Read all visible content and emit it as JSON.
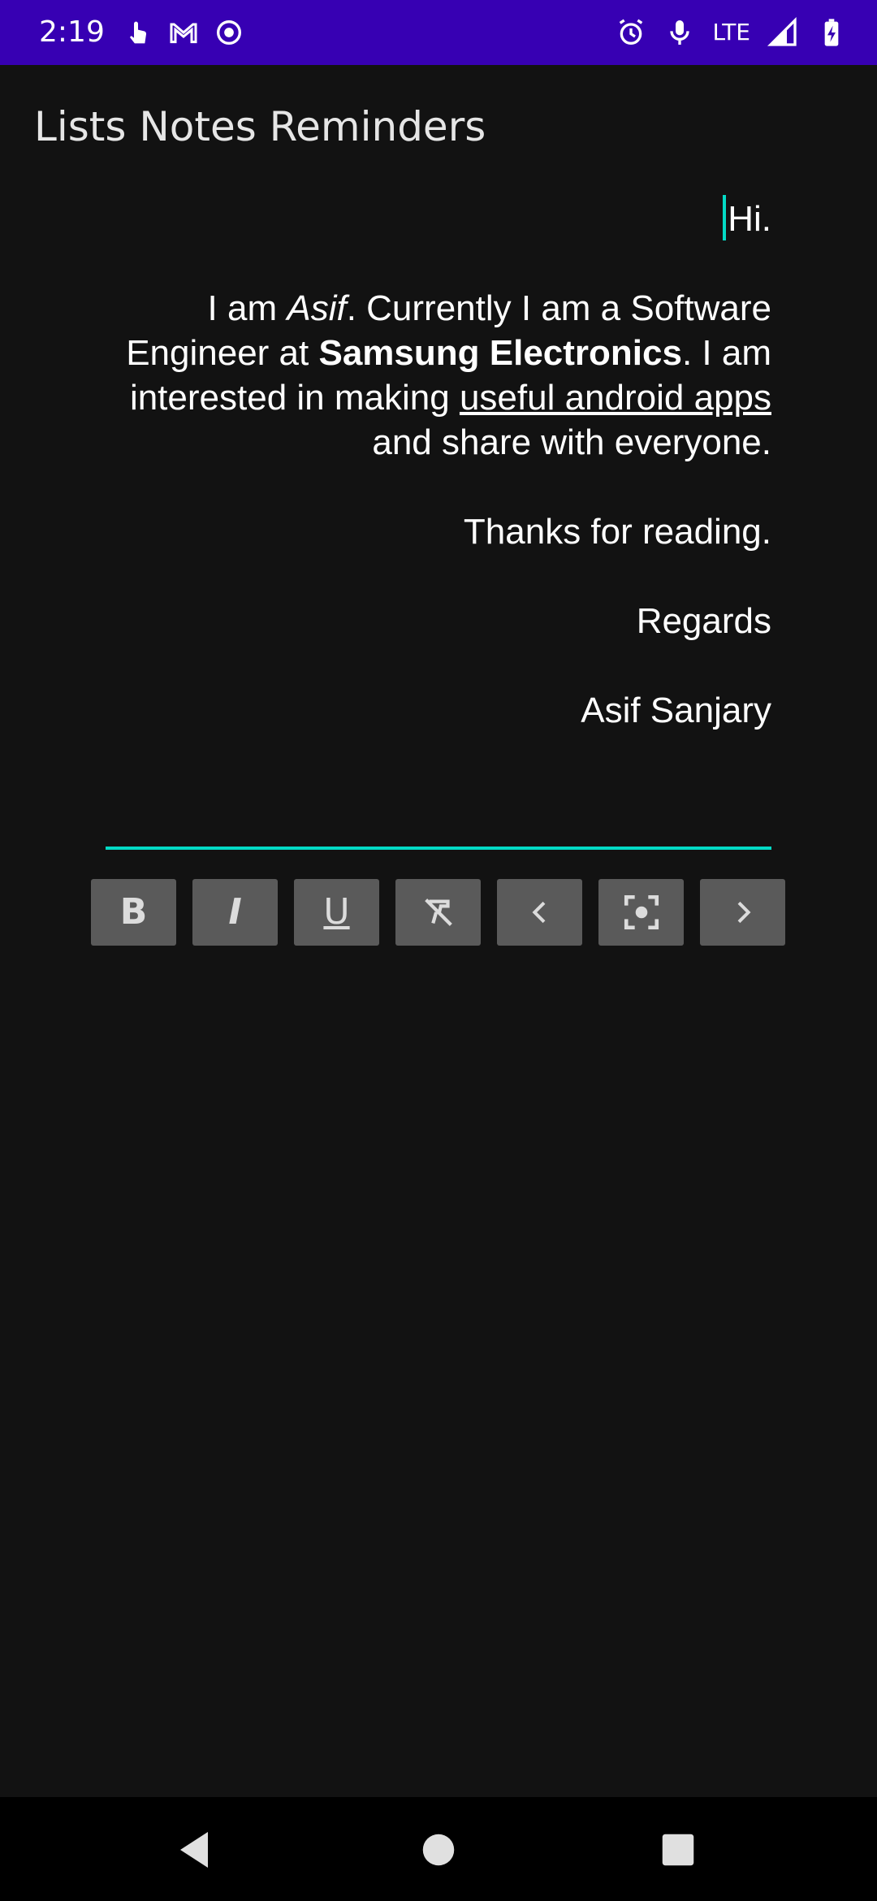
{
  "status_bar": {
    "time": "2:19",
    "network": "LTE",
    "icons_left": [
      "touch-icon",
      "gmail-icon",
      "record-icon"
    ],
    "icons_right": [
      "alarm-icon",
      "microphone-icon",
      "signal-icon",
      "battery-charging-icon"
    ],
    "background_color": "#3700b3"
  },
  "app_bar": {
    "title": "Lists Notes Reminders"
  },
  "editor": {
    "accent_color": "#03dac5",
    "greeting": "Hi.",
    "intro": {
      "t1": "I am ",
      "name_italic": "Asif",
      "t2": ". Currently I am a Software Engineer at ",
      "company_bold": "Samsung Electronics",
      "t3": ". I am interested in making ",
      "underlined": "useful android apps",
      "t4": " and share with everyone."
    },
    "thanks": "Thanks for reading.",
    "regards": "Regards",
    "signature": "Asif Sanjary"
  },
  "toolbar": {
    "buttons": [
      {
        "name": "bold",
        "glyph": "B"
      },
      {
        "name": "italic",
        "glyph": "I"
      },
      {
        "name": "underline",
        "glyph": "U"
      },
      {
        "name": "clear-format",
        "glyph": "T"
      },
      {
        "name": "previous",
        "glyph": "‹"
      },
      {
        "name": "capture",
        "glyph": "◉"
      },
      {
        "name": "next",
        "glyph": "›"
      }
    ]
  },
  "nav_bar": {
    "buttons": [
      "back-icon",
      "home-icon",
      "recents-icon"
    ]
  }
}
